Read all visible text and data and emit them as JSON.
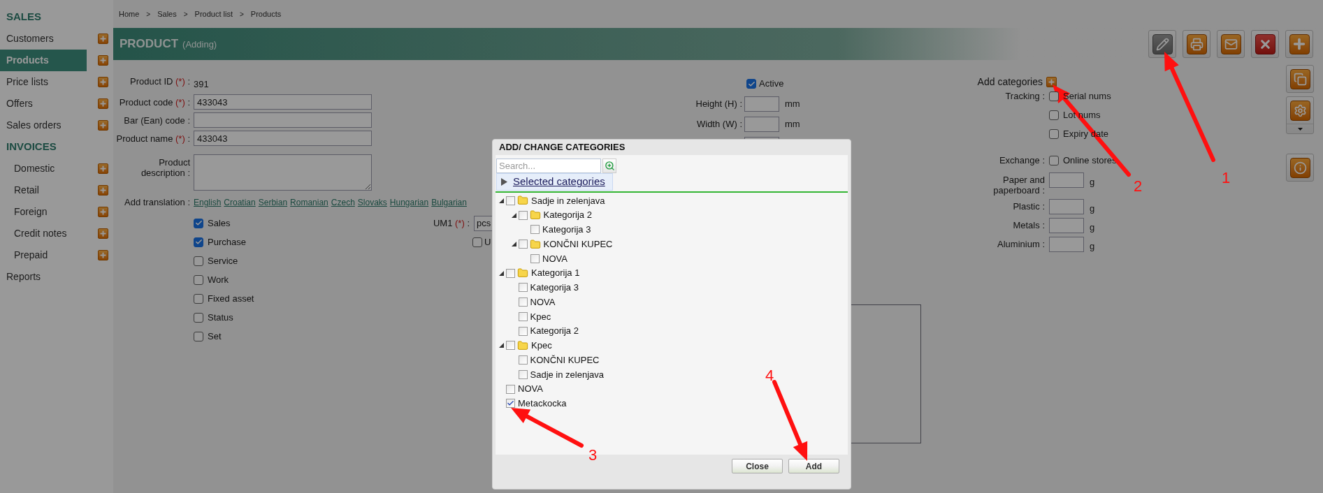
{
  "breadcrumb": {
    "items": [
      "Home",
      "Sales",
      "Product list",
      "Products"
    ],
    "separator": ">"
  },
  "sidebar": {
    "items": [
      {
        "kind": "heading",
        "label": "SALES"
      },
      {
        "kind": "item",
        "label": "Customers",
        "selected": false
      },
      {
        "kind": "item",
        "label": "Products",
        "selected": true
      },
      {
        "kind": "item",
        "label": "Price lists",
        "selected": false
      },
      {
        "kind": "item",
        "label": "Offers",
        "selected": false
      },
      {
        "kind": "item",
        "label": "Sales orders",
        "selected": false
      },
      {
        "kind": "heading",
        "label": "INVOICES"
      },
      {
        "kind": "subitem",
        "label": "Domestic",
        "selected": false
      },
      {
        "kind": "subitem",
        "label": "Retail",
        "selected": false
      },
      {
        "kind": "subitem",
        "label": "Foreign",
        "selected": false
      },
      {
        "kind": "subitem",
        "label": "Credit notes",
        "selected": false
      },
      {
        "kind": "subitem",
        "label": "Prepaid",
        "selected": false
      },
      {
        "kind": "plain",
        "label": "Reports",
        "selected": false
      }
    ]
  },
  "header": {
    "title": "PRODUCT",
    "subtitle": "(Adding)"
  },
  "toolbar": [
    {
      "kind": "edit",
      "disabled": true
    },
    {
      "kind": "print",
      "disabled": false
    },
    {
      "kind": "email",
      "disabled": false
    },
    {
      "kind": "delete",
      "disabled": false
    },
    {
      "kind": "add",
      "disabled": false
    }
  ],
  "side_toolbar": [
    {
      "kind": "copy",
      "dropdown": false
    },
    {
      "kind": "settings",
      "dropdown": true
    },
    {
      "kind": "info",
      "dropdown": false
    }
  ],
  "form": {
    "fields": [
      {
        "kind": "static",
        "label": "Product ID",
        "required": "(*)",
        "colon": ":",
        "value": "391"
      },
      {
        "kind": "input",
        "label": "Product code",
        "required": "(*)",
        "colon": ":",
        "value": "433043"
      },
      {
        "kind": "input",
        "label": "Bar (Ean) code",
        "colon": ":"
      },
      {
        "kind": "input",
        "label": "Product name",
        "required": "(*)",
        "colon": ":",
        "value": "433043"
      },
      {
        "kind": "textarea",
        "label": "Product description",
        "colon": ":"
      }
    ],
    "translation": {
      "label": "Add translation",
      "colon": ":",
      "languages": [
        "English",
        "Croatian",
        "Serbian",
        "Romanian",
        "Czech",
        "Slovaks",
        "Hungarian",
        "Bulgarian"
      ]
    },
    "flags": [
      {
        "label": "Sales",
        "checked": true
      },
      {
        "label": "Purchase",
        "checked": true
      },
      {
        "label": "Service",
        "checked": false
      },
      {
        "label": "Work",
        "checked": false
      },
      {
        "label": "Fixed asset",
        "checked": false
      },
      {
        "label": "Status",
        "checked": false
      },
      {
        "label": "Set",
        "checked": false
      }
    ],
    "um1": {
      "label": "UM1",
      "required": "(*)",
      "colon": ":",
      "value": "pcs"
    },
    "um_option": {
      "label": "U",
      "checked": false
    }
  },
  "dimensions": {
    "active": {
      "label": "Active",
      "checked": true
    },
    "rows": [
      {
        "label": "Height (H)",
        "colon": ":",
        "unit": "mm"
      },
      {
        "label": "Width (W)",
        "colon": ":",
        "unit": "mm"
      }
    ]
  },
  "categories_panel": {
    "add_label": "Add categories",
    "tracking": {
      "label": "Tracking",
      "colon": ":",
      "options": [
        {
          "label": "Serial nums",
          "checked": false
        },
        {
          "label": "Lot nums",
          "checked": false
        },
        {
          "label": "Expiry date",
          "checked": false
        }
      ]
    },
    "exchange": {
      "label": "Exchange",
      "colon": ":",
      "option": {
        "label": "Online stores",
        "checked": false
      }
    },
    "weights": [
      {
        "label": "Paper and paperboard",
        "colon": ":",
        "unit": "g"
      },
      {
        "label": "Plastic",
        "colon": ":",
        "unit": "g"
      },
      {
        "label": "Metals",
        "colon": ":",
        "unit": "g"
      },
      {
        "label": "Aluminium",
        "colon": ":",
        "unit": "g"
      }
    ]
  },
  "dialog": {
    "title": "ADD/ CHANGE CATEGORIES",
    "placeholder": "Search...",
    "selected_link": "Selected categories",
    "tree": [
      {
        "kind": "folder",
        "label": "Sadje in zelenjava",
        "checked": false,
        "expanded": true,
        "children": [
          {
            "kind": "folder",
            "label": "Kategorija 2",
            "checked": false,
            "expanded": true,
            "children": [
              {
                "kind": "item",
                "label": "Kategorija 3",
                "checked": false
              }
            ]
          },
          {
            "kind": "folder",
            "label": "KONČNI KUPEC",
            "checked": false,
            "expanded": true,
            "children": [
              {
                "kind": "item",
                "label": "NOVA",
                "checked": false
              }
            ]
          }
        ]
      },
      {
        "kind": "folder",
        "label": "Kategorija 1",
        "checked": false,
        "expanded": true,
        "children": [
          {
            "kind": "item",
            "label": "Kategorija 3",
            "checked": false
          },
          {
            "kind": "item",
            "label": "NOVA",
            "checked": false
          },
          {
            "kind": "item",
            "label": "Kpec",
            "checked": false
          },
          {
            "kind": "item",
            "label": "Kategorija 2",
            "checked": false
          }
        ]
      },
      {
        "kind": "folder",
        "label": "Kpec",
        "checked": false,
        "expanded": true,
        "children": [
          {
            "kind": "item",
            "label": "KONČNI KUPEC",
            "checked": false
          },
          {
            "kind": "item",
            "label": "Sadje in zelenjava",
            "checked": false
          }
        ]
      },
      {
        "kind": "item",
        "label": "NOVA",
        "checked": false
      },
      {
        "kind": "item",
        "label": "Metackocka",
        "checked": true
      }
    ],
    "buttons": [
      "Close",
      "Add"
    ]
  },
  "annotations": [
    {
      "label": "1"
    },
    {
      "label": "2"
    },
    {
      "label": "3"
    },
    {
      "label": "4"
    }
  ]
}
